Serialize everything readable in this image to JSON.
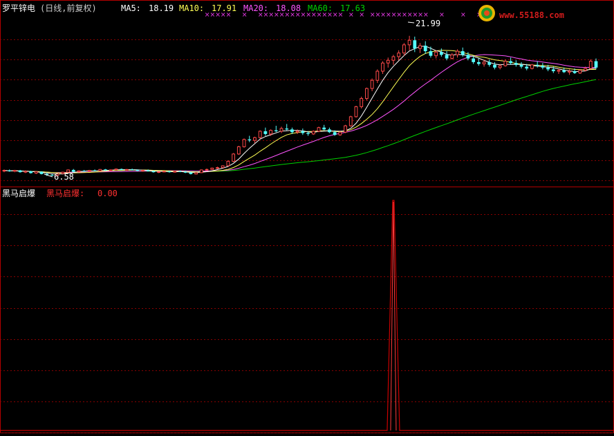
{
  "title_bar": {
    "stock_name": "罗平锌电",
    "period_tag": "(日线,前复权)",
    "ma5_label": "MA5:",
    "ma5_value": "18.19",
    "ma10_label": "MA10:",
    "ma10_value": "17.91",
    "ma20_label": "MA20:",
    "ma20_value": "18.08",
    "ma60_label": "MA60:",
    "ma60_value": "17.63"
  },
  "watermark": {
    "text": "www.55188.com"
  },
  "price_panel": {
    "high_label": "21.99",
    "low_label": "6.58"
  },
  "indicator_panel": {
    "name": "黑马启爆",
    "value_label": "黑马启爆:",
    "value": "0.00"
  },
  "colors": {
    "up": "#ff4a4a",
    "down": "#54ffff",
    "ma5": "#ffffff",
    "ma10": "#ffff55",
    "ma20": "#ff55ff",
    "ma60": "#00d200",
    "border": "#b40000",
    "grid": "#8b0000",
    "signal": "#cc0000",
    "marker": "#cc33cc"
  },
  "chart_data": [
    {
      "type": "candlestick",
      "title": "罗平锌电(日线,前复权)",
      "ylim": [
        5.8,
        23.8
      ],
      "grid": true,
      "series_labels": [
        "MA5",
        "MA10",
        "MA20",
        "MA60"
      ],
      "ohlc": [
        [
          7.15,
          7.3,
          7.0,
          7.2
        ],
        [
          7.2,
          7.3,
          7.05,
          7.1
        ],
        [
          7.1,
          7.25,
          7.0,
          7.2
        ],
        [
          7.2,
          7.25,
          6.95,
          7.0
        ],
        [
          7.0,
          7.2,
          6.9,
          7.1
        ],
        [
          7.1,
          7.15,
          6.85,
          6.9
        ],
        [
          6.9,
          7.1,
          6.8,
          7.05
        ],
        [
          7.05,
          7.1,
          6.75,
          6.8
        ],
        [
          6.8,
          6.95,
          6.6,
          6.7
        ],
        [
          6.7,
          6.8,
          6.58,
          6.65
        ],
        [
          6.65,
          6.9,
          6.6,
          6.85
        ],
        [
          6.85,
          7.05,
          6.8,
          7.0
        ],
        [
          7.0,
          7.3,
          6.95,
          7.25
        ],
        [
          7.25,
          7.35,
          7.0,
          7.05
        ],
        [
          7.05,
          7.2,
          7.0,
          7.15
        ],
        [
          7.15,
          7.25,
          7.05,
          7.1
        ],
        [
          7.1,
          7.25,
          7.05,
          7.2
        ],
        [
          7.2,
          7.3,
          7.1,
          7.15
        ],
        [
          7.15,
          7.35,
          7.1,
          7.3
        ],
        [
          7.3,
          7.35,
          7.15,
          7.2
        ],
        [
          7.2,
          7.3,
          7.1,
          7.25
        ],
        [
          7.25,
          7.4,
          7.2,
          7.35
        ],
        [
          7.35,
          7.4,
          7.2,
          7.25
        ],
        [
          7.25,
          7.35,
          7.15,
          7.3
        ],
        [
          7.3,
          7.4,
          7.2,
          7.25
        ],
        [
          7.25,
          7.3,
          7.1,
          7.15
        ],
        [
          7.15,
          7.25,
          7.05,
          7.2
        ],
        [
          7.2,
          7.3,
          7.1,
          7.1
        ],
        [
          7.1,
          7.2,
          6.95,
          7.0
        ],
        [
          7.0,
          7.1,
          6.9,
          7.05
        ],
        [
          7.05,
          7.15,
          7.0,
          7.1
        ],
        [
          7.1,
          7.15,
          6.95,
          7.0
        ],
        [
          7.0,
          7.15,
          6.95,
          7.1
        ],
        [
          7.1,
          7.2,
          7.0,
          7.05
        ],
        [
          7.05,
          7.15,
          6.9,
          6.95
        ],
        [
          6.95,
          7.05,
          6.75,
          6.8
        ],
        [
          6.8,
          7.0,
          6.75,
          6.95
        ],
        [
          6.95,
          7.3,
          6.9,
          7.25
        ],
        [
          7.25,
          7.4,
          7.15,
          7.3
        ],
        [
          7.3,
          7.5,
          7.25,
          7.45
        ],
        [
          7.45,
          7.6,
          7.35,
          7.5
        ],
        [
          7.5,
          7.75,
          7.45,
          7.7
        ],
        [
          7.7,
          8.3,
          7.65,
          8.2
        ],
        [
          8.2,
          9.1,
          8.1,
          9.0
        ],
        [
          9.0,
          9.9,
          8.9,
          9.8
        ],
        [
          9.8,
          10.7,
          9.7,
          10.6
        ],
        [
          10.6,
          11.0,
          10.3,
          10.5
        ],
        [
          10.5,
          10.9,
          10.2,
          10.8
        ],
        [
          10.8,
          11.6,
          10.7,
          11.5
        ],
        [
          11.5,
          11.9,
          11.0,
          11.2
        ],
        [
          11.2,
          11.7,
          11.0,
          11.6
        ],
        [
          11.6,
          12.1,
          11.4,
          11.5
        ],
        [
          11.5,
          12.0,
          11.3,
          11.8
        ],
        [
          11.8,
          12.3,
          11.6,
          11.7
        ],
        [
          11.7,
          11.9,
          11.2,
          11.4
        ],
        [
          11.4,
          11.7,
          11.2,
          11.5
        ],
        [
          11.5,
          11.8,
          11.1,
          11.3
        ],
        [
          11.3,
          11.5,
          11.0,
          11.2
        ],
        [
          11.2,
          11.6,
          11.1,
          11.5
        ],
        [
          11.5,
          12.0,
          11.4,
          11.9
        ],
        [
          11.9,
          12.2,
          11.6,
          11.7
        ],
        [
          11.7,
          11.9,
          11.3,
          11.4
        ],
        [
          11.4,
          11.6,
          11.0,
          11.1
        ],
        [
          11.1,
          11.5,
          11.0,
          11.4
        ],
        [
          11.4,
          12.2,
          11.3,
          12.1
        ],
        [
          12.1,
          13.2,
          12.0,
          13.1
        ],
        [
          13.1,
          14.3,
          13.0,
          14.2
        ],
        [
          14.2,
          15.3,
          14.0,
          15.1
        ],
        [
          15.1,
          16.3,
          14.9,
          16.2
        ],
        [
          16.2,
          17.3,
          15.9,
          17.1
        ],
        [
          17.1,
          18.3,
          16.8,
          18.1
        ],
        [
          18.1,
          19.2,
          17.8,
          19.0
        ],
        [
          19.0,
          19.6,
          18.5,
          19.3
        ],
        [
          19.3,
          19.9,
          18.8,
          19.7
        ],
        [
          19.7,
          20.4,
          19.3,
          20.1
        ],
        [
          20.1,
          21.2,
          19.8,
          21.0
        ],
        [
          21.0,
          21.99,
          20.4,
          21.5
        ],
        [
          21.5,
          21.9,
          20.2,
          20.6
        ],
        [
          20.6,
          21.2,
          20.1,
          20.9
        ],
        [
          20.9,
          21.4,
          20.0,
          20.3
        ],
        [
          20.3,
          20.8,
          19.6,
          19.8
        ],
        [
          19.8,
          20.4,
          19.5,
          20.2
        ],
        [
          20.2,
          20.6,
          19.7,
          19.9
        ],
        [
          19.9,
          20.3,
          19.3,
          19.5
        ],
        [
          19.5,
          20.1,
          19.4,
          19.9
        ],
        [
          19.9,
          20.5,
          19.6,
          20.3
        ],
        [
          20.3,
          20.7,
          19.7,
          19.9
        ],
        [
          19.9,
          20.2,
          19.3,
          19.5
        ],
        [
          19.5,
          19.8,
          18.9,
          19.1
        ],
        [
          19.1,
          19.5,
          18.7,
          18.9
        ],
        [
          18.9,
          19.3,
          18.6,
          19.1
        ],
        [
          19.1,
          19.4,
          18.6,
          18.8
        ],
        [
          18.8,
          19.1,
          18.3,
          18.5
        ],
        [
          18.5,
          18.9,
          18.3,
          18.7
        ],
        [
          18.7,
          19.4,
          18.6,
          19.2
        ],
        [
          19.2,
          19.6,
          18.8,
          19.0
        ],
        [
          19.0,
          19.3,
          18.6,
          18.8
        ],
        [
          18.8,
          19.1,
          18.4,
          18.6
        ],
        [
          18.6,
          18.9,
          18.2,
          18.4
        ],
        [
          18.4,
          18.9,
          18.3,
          18.8
        ],
        [
          18.8,
          19.2,
          18.5,
          18.7
        ],
        [
          18.7,
          19.0,
          18.3,
          18.5
        ],
        [
          18.5,
          18.8,
          18.1,
          18.3
        ],
        [
          18.3,
          18.6,
          17.9,
          18.1
        ],
        [
          18.1,
          18.4,
          17.8,
          18.2
        ],
        [
          18.2,
          18.5,
          17.9,
          18.0
        ],
        [
          18.0,
          18.3,
          17.7,
          18.1
        ],
        [
          18.1,
          18.4,
          17.8,
          17.9
        ],
        [
          17.9,
          18.3,
          17.8,
          18.2
        ],
        [
          18.2,
          18.6,
          18.1,
          18.4
        ],
        [
          18.4,
          19.4,
          18.3,
          19.2
        ],
        [
          19.2,
          19.5,
          18.3,
          18.5
        ]
      ]
    },
    {
      "type": "line",
      "title": "黑马启爆",
      "ylim": [
        0,
        1
      ],
      "grid": true,
      "signal_index": 73,
      "values_note": "0 everywhere except a single spike at signal_index",
      "series": [
        {
          "name": "黑马启爆",
          "spike_value": 1
        }
      ]
    }
  ]
}
